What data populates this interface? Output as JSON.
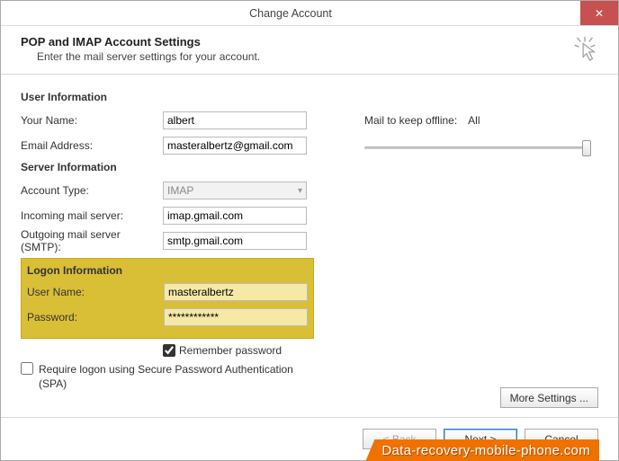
{
  "window": {
    "title": "Change Account"
  },
  "header": {
    "title": "POP and IMAP Account Settings",
    "subtitle": "Enter the mail server settings for your account."
  },
  "sections": {
    "user_info": "User Information",
    "server_info": "Server Information",
    "logon_info": "Logon Information"
  },
  "labels": {
    "your_name": "Your Name:",
    "email": "Email Address:",
    "account_type": "Account Type:",
    "incoming": "Incoming mail server:",
    "outgoing": "Outgoing mail server (SMTP):",
    "user_name": "User Name:",
    "password": "Password:",
    "remember_password": "Remember password",
    "require_spa": "Require logon using Secure Password Authentication (SPA)",
    "mail_to_keep": "Mail to keep offline:",
    "mail_keep_value": "All"
  },
  "values": {
    "your_name": "albert",
    "email": "masteralbertz@gmail.com",
    "account_type": "IMAP",
    "incoming": "imap.gmail.com",
    "outgoing": "smtp.gmail.com",
    "user_name": "masteralbertz",
    "password": "************"
  },
  "buttons": {
    "more_settings": "More Settings ...",
    "back": "< Back",
    "next": "Next >",
    "cancel": "Cancel"
  },
  "brand": "Data-recovery-mobile-phone.com"
}
